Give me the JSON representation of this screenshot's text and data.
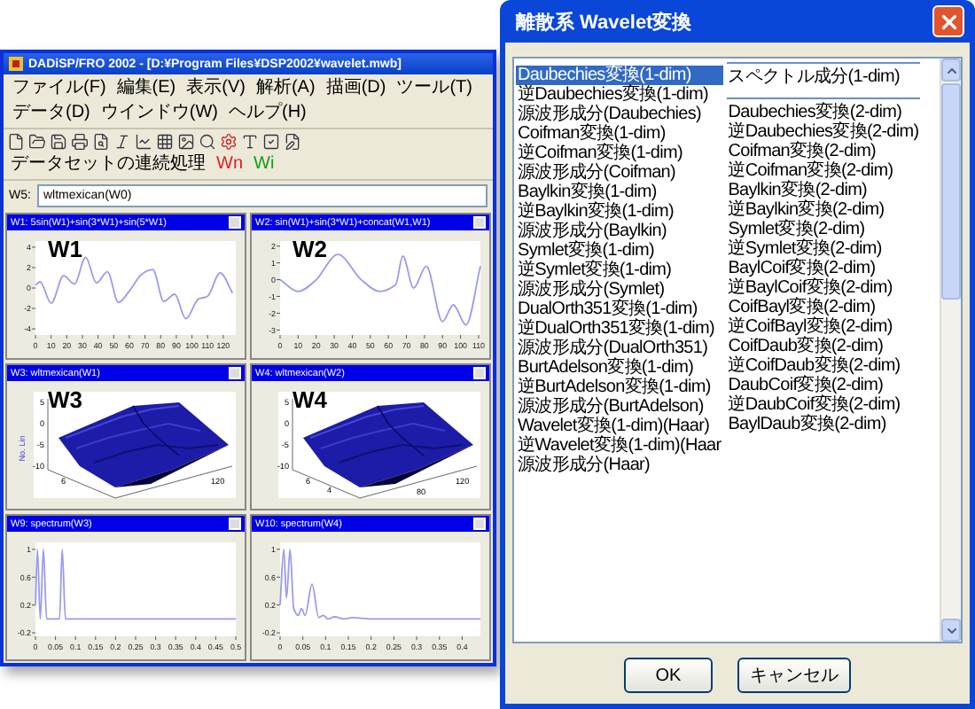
{
  "main_window": {
    "title": "DADiSP/FRO 2002 - [D:¥Program Files¥DSP2002¥wavelet.mwb]",
    "menu": [
      "ファイル(F)",
      "編集(E)",
      "表示(V)",
      "解析(A)",
      "描画(D)",
      "ツール(T)",
      "データ(D)",
      "ウインドウ(W)",
      "ヘルプ(H)"
    ],
    "toolbar_labels": [
      {
        "text": "データセットの連続処理",
        "color": "#000000"
      },
      {
        "text": "Wn",
        "color": "#e02020"
      },
      {
        "text": "Wi",
        "color": "#10a010"
      }
    ],
    "formula": {
      "label": "W5:",
      "value": "wltmexican(W0)"
    },
    "windows": [
      {
        "title": "W1: 5sin(W1)+sin(3*W1)+sin(5*W1)",
        "label": "W1",
        "kind": "line",
        "chart_data": {
          "type": "line",
          "xlim": [
            0,
            128
          ],
          "ylim": [
            -4.6,
            4.6
          ],
          "xticks": [
            0,
            10,
            20,
            30,
            40,
            50,
            60,
            70,
            80,
            90,
            100,
            110,
            120
          ],
          "yticks": [
            -4,
            -2,
            0,
            2,
            4
          ],
          "x": [
            0,
            3,
            10,
            18,
            25,
            32,
            39,
            46,
            53,
            60,
            67,
            75,
            82,
            89,
            96,
            104,
            110,
            118,
            126
          ],
          "series": [
            {
              "color": "#9a9af0",
              "values": [
                0.3,
                0.6,
                -1.5,
                1.2,
                0.4,
                3,
                0.5,
                1.6,
                -1.4,
                -0.3,
                1.2,
                1.8,
                -1.3,
                -0.6,
                -3,
                -1.1,
                -0.8,
                1.5,
                -0.5
              ]
            }
          ]
        }
      },
      {
        "title": "W2: sin(W1)+sin(3*W1)+concat(W1,W1)",
        "label": "W2",
        "kind": "line",
        "chart_data": {
          "type": "line",
          "xlim": [
            0,
            111
          ],
          "ylim": [
            -3.3,
            2.3
          ],
          "xticks": [
            0,
            10,
            20,
            30,
            40,
            50,
            60,
            70,
            80,
            90,
            100,
            110
          ],
          "yticks": [
            -3,
            -2,
            -1,
            0,
            1,
            2
          ],
          "x": [
            0,
            10,
            20,
            32,
            45,
            55,
            64,
            68,
            74,
            81,
            90,
            96,
            103,
            111
          ],
          "series": [
            {
              "color": "#9a9af0",
              "values": [
                0,
                -0.7,
                0,
                1.5,
                0,
                -0.7,
                -0.3,
                1.4,
                -0.5,
                0.8,
                -2.5,
                -1.5,
                -2.7,
                0.8
              ]
            }
          ]
        }
      },
      {
        "title": "W3: wltmexican(W1)",
        "label": "W3",
        "kind": "surface",
        "axis_title": "No. Lin",
        "z_ticks": [
          "5",
          "0",
          "-5",
          "-10"
        ],
        "y_ticks": [
          "6"
        ],
        "x_ticks": [
          "120"
        ]
      },
      {
        "title": "W4: wltmexican(W2)",
        "label": "W4",
        "kind": "surface",
        "z_ticks": [
          "5",
          "0",
          "-5",
          "-10"
        ],
        "y_ticks": [
          "6",
          "4"
        ],
        "x_ticks": [
          "120",
          "80"
        ]
      },
      {
        "title": "W9: spectrum(W3)",
        "kind": "line",
        "chart_data": {
          "type": "line",
          "xlim": [
            0,
            0.5
          ],
          "ylim": [
            -0.25,
            1.1
          ],
          "xticks": [
            0,
            0.05,
            0.1,
            0.15,
            0.2,
            0.25,
            0.3,
            0.35,
            0.4,
            0.45,
            0.5
          ],
          "yticks": [
            -0.2,
            0.2,
            0.6,
            1
          ],
          "x": [
            0,
            0.005,
            0.012,
            0.02,
            0.028,
            0.06,
            0.067,
            0.075,
            0.5
          ],
          "series": [
            {
              "color": "#9a9af0",
              "values": [
                0.2,
                1,
                0,
                1,
                0,
                0,
                1,
                0,
                0
              ]
            }
          ]
        }
      },
      {
        "title": "W10: spectrum(W4)",
        "kind": "line",
        "chart_data": {
          "type": "line",
          "xlim": [
            0,
            0.44
          ],
          "ylim": [
            -0.25,
            1.1
          ],
          "xticks": [
            0,
            0.05,
            0.1,
            0.15,
            0.2,
            0.25,
            0.3,
            0.35,
            0.4
          ],
          "yticks": [
            -0.2,
            0.2,
            0.6,
            1
          ],
          "x": [
            0,
            0.008,
            0.014,
            0.022,
            0.03,
            0.04,
            0.047,
            0.055,
            0.07,
            0.085,
            0.095,
            0.105,
            0.12,
            0.14,
            0.16,
            0.2,
            0.44
          ],
          "series": [
            {
              "color": "#9a9af0",
              "values": [
                0.2,
                1,
                0.3,
                1,
                0.15,
                0.05,
                0.15,
                0.05,
                0.5,
                0.02,
                0.05,
                0,
                0.03,
                0,
                0.02,
                0,
                0
              ]
            }
          ]
        }
      }
    ]
  },
  "dialog": {
    "title": "離散系 Wavelet変換",
    "groups": [
      {
        "items": [
          {
            "label": "Daubechies変換(1-dim)",
            "selected": true
          },
          {
            "label": "逆Daubechies変換(1-dim)",
            "selected": false
          },
          {
            "label": "源波形成分(Daubechies)",
            "selected": false
          },
          {
            "label": "Coifman変換(1-dim)",
            "selected": false
          },
          {
            "label": "逆Coifman変換(1-dim)",
            "selected": false
          },
          {
            "label": "源波形成分(Coifman)",
            "selected": false
          },
          {
            "label": "Baylkin変換(1-dim)",
            "selected": false
          },
          {
            "label": "逆Baylkin変換(1-dim)",
            "selected": false
          },
          {
            "label": "源波形成分(Baylkin)",
            "selected": false
          },
          {
            "label": "Symlet変換(1-dim)",
            "selected": false
          },
          {
            "label": "逆Symlet変換(1-dim)",
            "selected": false
          },
          {
            "label": "源波形成分(Symlet)",
            "selected": false
          },
          {
            "label": "DualOrth351変換(1-dim)",
            "selected": false
          },
          {
            "label": "逆DualOrth351変換(1-dim)",
            "selected": false
          },
          {
            "label": "源波形成分(DualOrth351)",
            "selected": false
          },
          {
            "label": "BurtAdelson変換(1-dim)",
            "selected": false
          },
          {
            "label": "逆BurtAdelson変換(1-dim)",
            "selected": false
          },
          {
            "label": "源波形成分(BurtAdelson)",
            "selected": false
          },
          {
            "label": "Wavelet変換(1-dim)(Haar)",
            "selected": false
          },
          {
            "label": "逆Wavelet変換(1-dim)(Haar",
            "selected": false
          },
          {
            "label": "源波形成分(Haar)",
            "selected": false
          }
        ]
      },
      {
        "items": [
          {
            "label": "スペクトル成分(1-dim)",
            "selected": false
          }
        ]
      },
      {
        "items": [
          {
            "label": "Daubechies変換(2-dim)",
            "selected": false
          },
          {
            "label": "逆Daubechies変換(2-dim)",
            "selected": false
          },
          {
            "label": "Coifman変換(2-dim)",
            "selected": false
          },
          {
            "label": "逆Coifman変換(2-dim)",
            "selected": false
          },
          {
            "label": "Baylkin変換(2-dim)",
            "selected": false
          },
          {
            "label": "逆Baylkin変換(2-dim)",
            "selected": false
          },
          {
            "label": "Symlet変換(2-dim)",
            "selected": false
          },
          {
            "label": "逆Symlet変換(2-dim)",
            "selected": false
          },
          {
            "label": "BaylCoif変換(2-dim)",
            "selected": false
          },
          {
            "label": "逆BaylCoif変換(2-dim)",
            "selected": false
          },
          {
            "label": "CoifBayl変換(2-dim)",
            "selected": false
          },
          {
            "label": "逆CoifBayl変換(2-dim)",
            "selected": false
          },
          {
            "label": "CoifDaub変換(2-dim)",
            "selected": false
          },
          {
            "label": "逆CoifDaub変換(2-dim)",
            "selected": false
          },
          {
            "label": "DaubCoif変換(2-dim)",
            "selected": false
          },
          {
            "label": "逆DaubCoif変換(2-dim)",
            "selected": false
          },
          {
            "label": "BaylDaub変換(2-dim)",
            "selected": false
          }
        ]
      }
    ],
    "buttons": [
      "OK",
      "キャンセル"
    ]
  }
}
